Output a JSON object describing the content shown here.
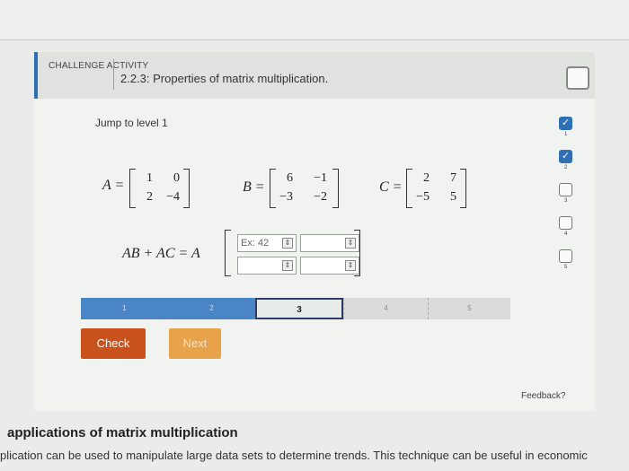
{
  "activity": {
    "badge": "CHALLENGE ACTIVITY",
    "title": "2.2.3: Properties of matrix multiplication.",
    "jump_text": "Jump to level 1"
  },
  "matrices": {
    "A": {
      "label": "A =",
      "rows": [
        [
          "1",
          "0"
        ],
        [
          "2",
          "−4"
        ]
      ]
    },
    "B": {
      "label": "B =",
      "rows": [
        [
          "6",
          "−1"
        ],
        [
          "−3",
          "−2"
        ]
      ]
    },
    "C": {
      "label": "C =",
      "rows": [
        [
          "2",
          "7"
        ],
        [
          "−5",
          "5"
        ]
      ]
    }
  },
  "equation": {
    "lhs": "AB + AC = A",
    "input_placeholder": "Ex: 42"
  },
  "progress": {
    "levels": [
      "1",
      "2",
      "3",
      "4",
      "5"
    ],
    "current": "3"
  },
  "buttons": {
    "check": "Check",
    "next": "Next"
  },
  "feedback": "Feedback?",
  "sidebar_levels": [
    {
      "num": "1",
      "done": true
    },
    {
      "num": "2",
      "done": true
    },
    {
      "num": "3",
      "done": false
    },
    {
      "num": "4",
      "done": false
    },
    {
      "num": "5",
      "done": false
    }
  ],
  "section": {
    "title": "applications of matrix multiplication",
    "text": "plication can be used to manipulate large data sets to determine trends. This technique can be useful in economic"
  },
  "colors": {
    "accent": "#2f6fb3",
    "check": "#c9521c",
    "next": "#e7a24a"
  }
}
